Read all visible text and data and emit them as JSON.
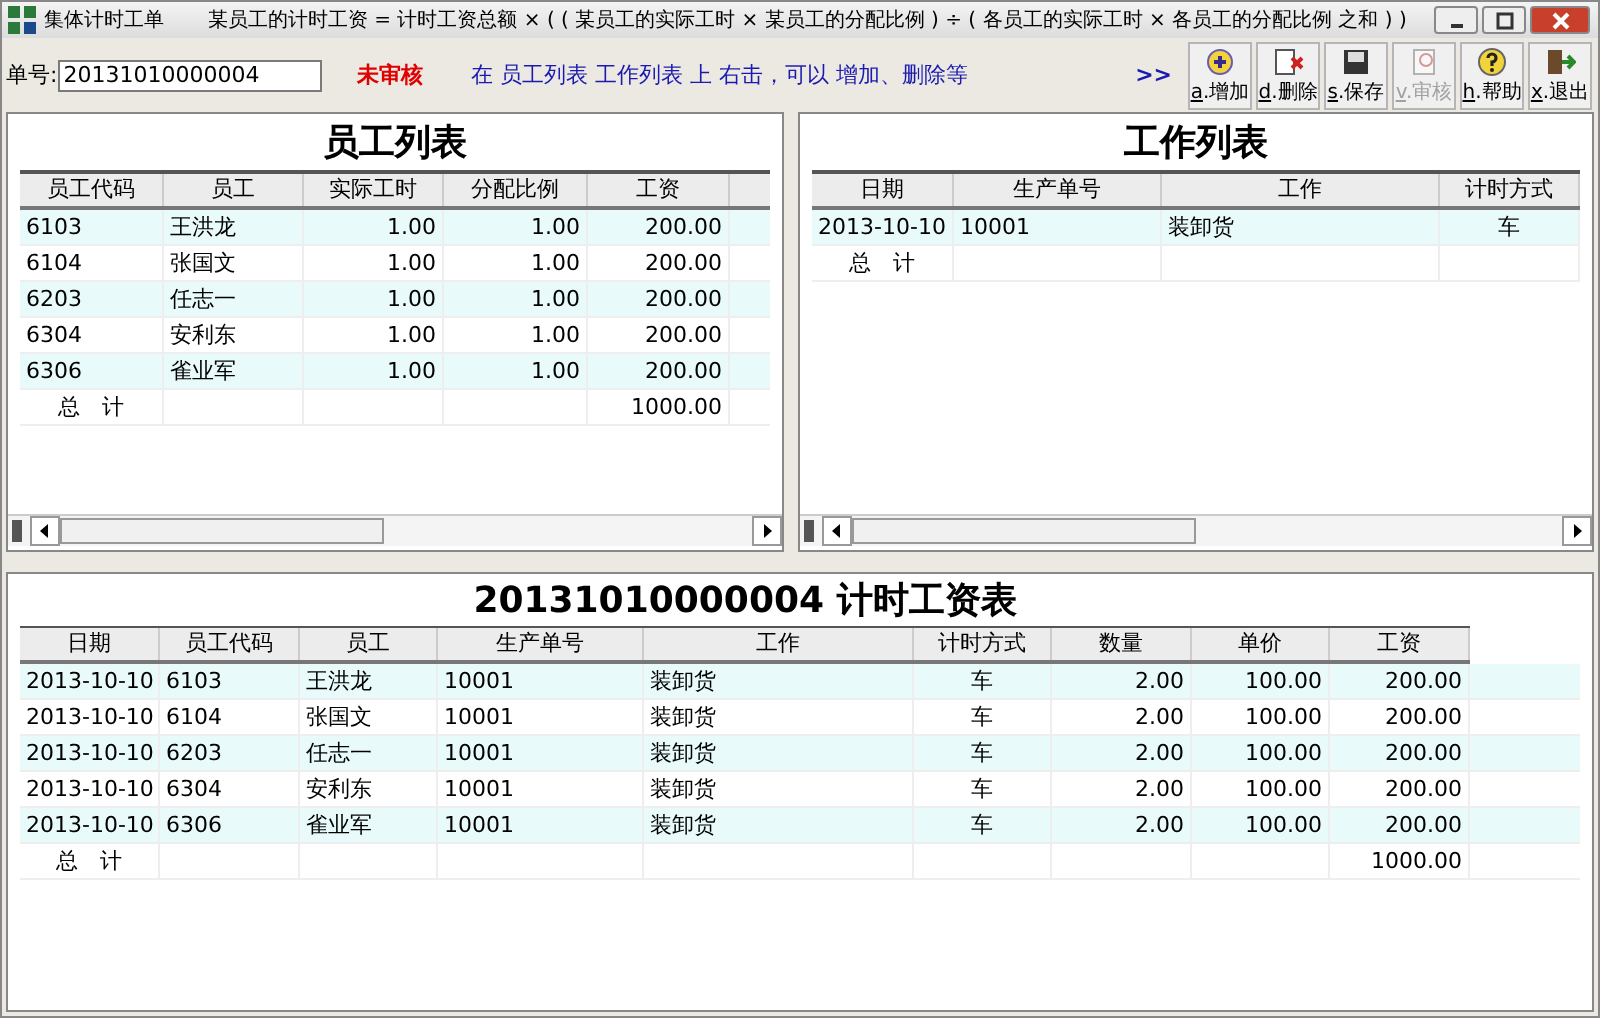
{
  "window": {
    "title": "集体计时工单",
    "formula": "某员工的计时工资 = 计时工资总额 × ( ( 某员工的实际工时 × 某员工的分配比例 ) ÷ ( 各员工的实际工时 × 各员工的分配比例 之和 ) )"
  },
  "toolbar": {
    "number_label": "单号:",
    "number_value": "20131010000004",
    "status": "未审核",
    "hint": "在 员工列表 工作列表 上 右击，可以 增加、删除等",
    "more": ">>",
    "buttons": [
      {
        "kind": "add",
        "label": "a.增加",
        "disabled": false
      },
      {
        "kind": "delete",
        "label": "d.删除",
        "disabled": false
      },
      {
        "kind": "save",
        "label": "s.保存",
        "disabled": false
      },
      {
        "kind": "audit",
        "label": "v.审核",
        "disabled": true
      },
      {
        "kind": "help",
        "label": "h.帮助",
        "disabled": false
      },
      {
        "kind": "exit",
        "label": "x.退出",
        "disabled": false
      }
    ]
  },
  "employee_list": {
    "title": "员工列表",
    "columns": [
      "员工代码",
      "员工",
      "实际工时",
      "分配比例",
      "工资"
    ],
    "rows": [
      [
        "6103",
        "王洪龙",
        "1.00",
        "1.00",
        "200.00"
      ],
      [
        "6104",
        "张国文",
        "1.00",
        "1.00",
        "200.00"
      ],
      [
        "6203",
        "任志一",
        "1.00",
        "1.00",
        "200.00"
      ],
      [
        "6304",
        "安利东",
        "1.00",
        "1.00",
        "200.00"
      ],
      [
        "6306",
        "雀业军",
        "1.00",
        "1.00",
        "200.00"
      ]
    ],
    "total": {
      "label": "总　计",
      "amount": "1000.00"
    }
  },
  "work_list": {
    "title": "工作列表",
    "columns": [
      "日期",
      "生产单号",
      "工作",
      "计时方式"
    ],
    "rows": [
      [
        "2013-10-10",
        "10001",
        "装卸货",
        "车"
      ]
    ],
    "total": {
      "label": "总　计"
    }
  },
  "wage_table": {
    "title": "20131010000004  计时工资表",
    "columns": [
      "日期",
      "员工代码",
      "员工",
      "生产单号",
      "工作",
      "计时方式",
      "数量",
      "单价",
      "工资"
    ],
    "rows": [
      [
        "2013-10-10",
        "6103",
        "王洪龙",
        "10001",
        "装卸货",
        "车",
        "2.00",
        "100.00",
        "200.00"
      ],
      [
        "2013-10-10",
        "6104",
        "张国文",
        "10001",
        "装卸货",
        "车",
        "2.00",
        "100.00",
        "200.00"
      ],
      [
        "2013-10-10",
        "6203",
        "任志一",
        "10001",
        "装卸货",
        "车",
        "2.00",
        "100.00",
        "200.00"
      ],
      [
        "2013-10-10",
        "6304",
        "安利东",
        "10001",
        "装卸货",
        "车",
        "2.00",
        "100.00",
        "200.00"
      ],
      [
        "2013-10-10",
        "6306",
        "雀业军",
        "10001",
        "装卸货",
        "车",
        "2.00",
        "100.00",
        "200.00"
      ]
    ],
    "total": {
      "label": "总　计",
      "amount": "1000.00"
    }
  }
}
